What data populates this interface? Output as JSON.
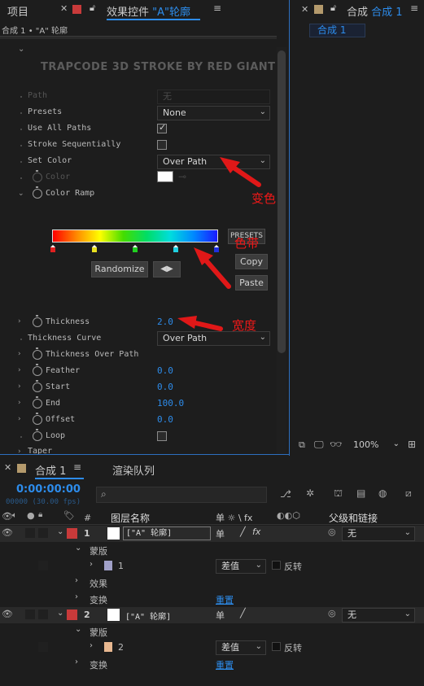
{
  "left_tabs": {
    "project": "项目",
    "effects_prefix": "效果控件",
    "effects_layer": "\"A\"轮廓"
  },
  "breadcrumb": "合成 1 • \"A\" 轮廓",
  "plugin_title": "TRAPCODE 3D STROKE BY RED GIANT",
  "props": {
    "path": {
      "label": "Path",
      "value": "无"
    },
    "presets": {
      "label": "Presets",
      "value": "None"
    },
    "use_all_paths": {
      "label": "Use All Paths",
      "checked": true
    },
    "stroke_seq": {
      "label": "Stroke Sequentially",
      "checked": false
    },
    "set_color": {
      "label": "Set Color",
      "value": "Over Path"
    },
    "color": {
      "label": "Color",
      "swatch": "#ffffff"
    },
    "color_ramp": {
      "label": "Color Ramp"
    },
    "thickness": {
      "label": "Thickness",
      "value": "2.0"
    },
    "thickness_curve": {
      "label": "Thickness Curve",
      "value": "Over Path"
    },
    "thickness_over_path": {
      "label": "Thickness Over Path"
    },
    "feather": {
      "label": "Feather",
      "value": "0.0"
    },
    "start": {
      "label": "Start",
      "value": "0.0"
    },
    "end": {
      "label": "End",
      "value": "100.0"
    },
    "offset": {
      "label": "Offset",
      "value": "0.0"
    },
    "loop": {
      "label": "Loop",
      "checked": false
    },
    "taper": {
      "label": "Taper"
    }
  },
  "ramp": {
    "presets_btn": "PRESETS",
    "copy_btn": "Copy",
    "paste_btn": "Paste",
    "randomize_btn": "Randomize",
    "stops": [
      "#e02020",
      "#e8e020",
      "#20d020",
      "#20d0e0",
      "#2030e0"
    ]
  },
  "annotations": {
    "color_change": "变色",
    "color_band": "色带",
    "width": "宽度"
  },
  "right_panel": {
    "tab_label": "合成",
    "tab_name": "合成 1",
    "comp_name": "合成 1",
    "zoom": "100%"
  },
  "timeline": {
    "tab_name": "合成 1",
    "render_queue": "渲染队列",
    "timecode": "0:00:00:00",
    "frames": "00000 (30.00 fps)",
    "search_placeholder": "",
    "col_hash": "#",
    "col_layer_name": "图层名称",
    "col_switches": "单 ☼ \\ fx",
    "col_parent": "父级和链接",
    "layers": [
      {
        "num": "1",
        "name": "[\"A\" 轮廓]",
        "parent": "无",
        "color": "#c83a3a"
      },
      {
        "num": "2",
        "name": "[\"A\" 轮廓]",
        "parent": "无",
        "color": "#c83a3a"
      }
    ],
    "masks_label": "蒙版",
    "mask1": {
      "num": "1",
      "mode": "差值",
      "invert": "反转",
      "color": "#a0a0c8"
    },
    "mask2": {
      "num": "2",
      "mode": "差值",
      "invert": "反转",
      "color": "#e8b890"
    },
    "effects_label": "效果",
    "transform_label": "变换",
    "reset_label": "重置"
  }
}
